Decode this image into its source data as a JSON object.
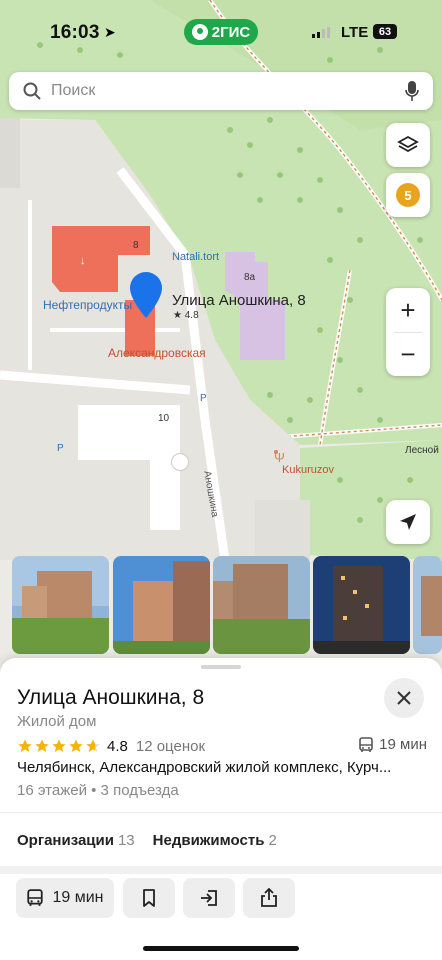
{
  "status": {
    "time": "16:03",
    "brand": "2ГИС",
    "network": "LTE",
    "battery": "63"
  },
  "search": {
    "placeholder": "Поиск"
  },
  "map": {
    "building_number_8": "8",
    "building_number_8a": "8а",
    "building_number_10": "10",
    "poi_natali": "Natali.tort",
    "poi_neft": "Нефтепродукты",
    "poi_street_red": "Александровская",
    "poi_kukuruzov": "Kukuruzov",
    "poi_lesnoy": "Лесной",
    "street_anoshkina": "Аношкина",
    "pin_title": "Улица Аношкина, 8",
    "pin_rating": "★ 4.8",
    "parking": "P",
    "notification_count": "5"
  },
  "card": {
    "title": "Улица Аношкина, 8",
    "type": "Жилой дом",
    "rating": "4.8",
    "rating_stars": 4.8,
    "rating_count": "12 оценок",
    "transit_time": "19 мин",
    "address": "Челябинск, Александровский жилой комплекс, Курч...",
    "floors": "16 этажей • 3 подъезда",
    "tabs": [
      {
        "label": "Организации",
        "count": "13"
      },
      {
        "label": "Недвижимость",
        "count": "2"
      }
    ],
    "actions": {
      "route_time": "19 мин"
    }
  },
  "colors": {
    "brand": "#1fa84a",
    "pin": "#1a73e8",
    "star": "#f5b400",
    "badge": "#e9a41f"
  }
}
